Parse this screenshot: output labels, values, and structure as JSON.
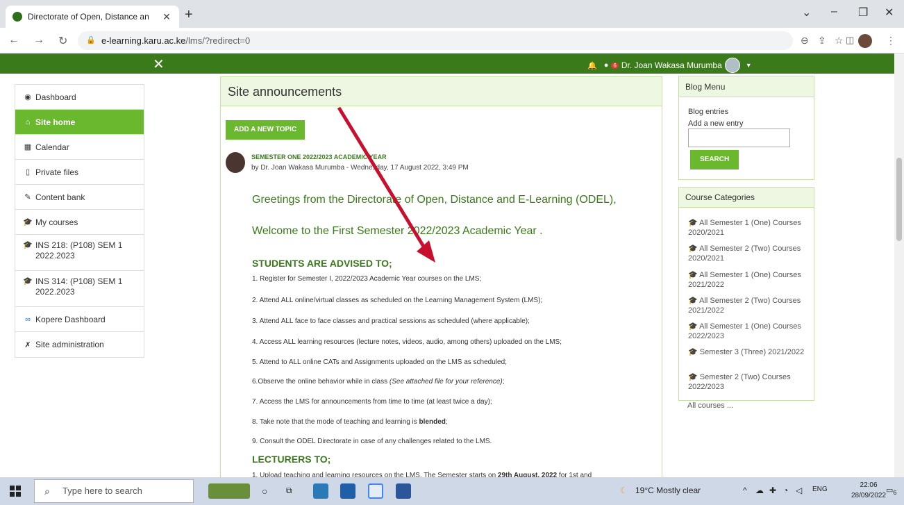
{
  "browser": {
    "tab_title": "Directorate of Open, Distance an",
    "url_host": "e-learning.karu.ac.ke",
    "url_path": "/lms/?redirect=0"
  },
  "header": {
    "notification_count": "6",
    "user_name": "Dr. Joan Wakasa Murumba"
  },
  "sidebar": {
    "items": [
      {
        "label": "Dashboard",
        "icon": "tachometer-icon"
      },
      {
        "label": "Site home",
        "icon": "home-icon"
      },
      {
        "label": "Calendar",
        "icon": "calendar-icon"
      },
      {
        "label": "Private files",
        "icon": "file-icon"
      },
      {
        "label": "Content bank",
        "icon": "paintbrush-icon"
      },
      {
        "label": "My courses",
        "icon": "graduation-cap-icon"
      },
      {
        "label": "INS 218: (P108) SEM 1 2022.2023",
        "icon": "graduation-cap-icon"
      },
      {
        "label": "INS 314: (P108) SEM 1 2022.2023",
        "icon": "graduation-cap-icon"
      },
      {
        "label": "Kopere Dashboard",
        "icon": "link-icon"
      },
      {
        "label": "Site administration",
        "icon": "wrench-icon"
      }
    ]
  },
  "main": {
    "title": "Site announcements",
    "add_topic": "ADD A NEW TOPIC",
    "post": {
      "subject": "SEMESTER ONE 2022/2023 ACADEMIC YEAR",
      "byline": "by Dr. Joan Wakasa Murumba - Wednesday, 17 August 2022, 3:49 PM",
      "greeting": "Greetings from the Directorate of Open, Distance and E-Learning (ODEL),",
      "welcome": "Welcome to the First Semester 2022/2023 Academic Year .",
      "students_heading": "STUDENTS ARE ADVISED TO;",
      "student_items": [
        "1. Register for Semester I, 2022/2023 Academic Year courses on the LMS;",
        "2. Attend ALL online/virtual classes as scheduled on the Learning Management System (LMS);",
        "3. Attend ALL face to face classes and practical sessions as scheduled (where applicable);",
        "4. Access ALL learning resources (lecture notes, videos, audio, among others) uploaded on the LMS;",
        "5. Attend to ALL online CATs and Assignments uploaded on the LMS as scheduled;",
        "6.Observe the online behavior while in class",
        "(See attached file for your reference)",
        "7. Access the LMS for announcements from time to time (at least twice a day);",
        "8. Take note that the mode of teaching and learning is",
        "blended",
        "9. Consult the ODEL Directorate in case of any challenges related to the LMS."
      ],
      "lecturers_heading": "LECTURERS TO;",
      "lecturer_item_start": "1. Upload teaching and learning resources on the LMS. The Semester starts on",
      "lecturer_item_date": "29th August, 2022",
      "lecturer_item_end": "for 1st and"
    }
  },
  "blog_menu": {
    "title": "Blog Menu",
    "entries": "Blog entries",
    "add_entry": "Add a new entry",
    "search": "SEARCH"
  },
  "course_categories": {
    "title": "Course Categories",
    "items": [
      "All Semester 1 (One) Courses 2020/2021",
      "All Semester 2 (Two) Courses 2020/2021",
      "All Semester 1 (One) Courses 2021/2022",
      "All Semester 2 (Two) Courses 2021/2022",
      "All Semester 1 (One) Courses 2022/2023",
      "Semester 3 (Three) 2021/2022",
      "Semester 2 (Two) Courses 2022/2023"
    ],
    "all_courses": "All courses ..."
  },
  "taskbar": {
    "search_placeholder": "Type here to search",
    "weather": "19°C  Mostly clear",
    "language": "ENG",
    "time": "22:06",
    "date": "28/09/2022",
    "notif_count": "6"
  },
  "colors": {
    "brand_green": "#3b7a1a",
    "accent_green": "#69b82e",
    "arrow_red": "#c8102e"
  }
}
